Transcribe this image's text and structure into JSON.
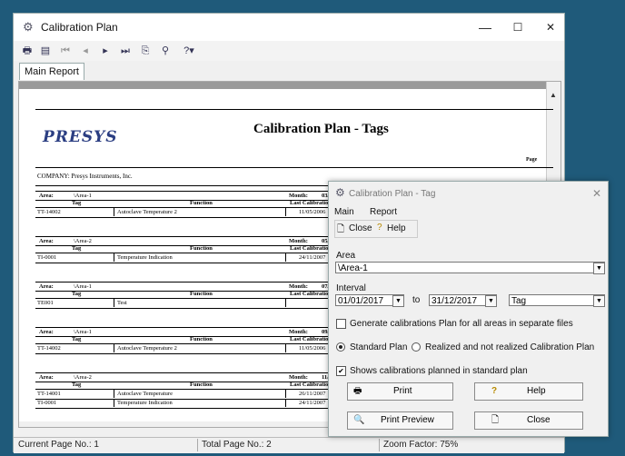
{
  "window": {
    "title": "Calibration Plan",
    "minimize": "—",
    "maximize": "☐",
    "close": "✕"
  },
  "toolbar": {
    "icons": [
      "print-setup-icon",
      "print-icon",
      "first-page-icon",
      "prev-page-icon",
      "next-page-icon",
      "last-page-icon",
      "export-icon",
      "find-icon",
      "help-icon"
    ]
  },
  "tabs": {
    "main": "Main Report"
  },
  "report": {
    "logo": "PRESYS",
    "title": "Calibration Plan - Tags",
    "page_label": "Page",
    "company": "COMPANY: Presys Instruments, Inc.",
    "col_tag": "Tag",
    "col_function": "Function",
    "col_last": "Last Calibratio",
    "area_label": "Area:",
    "month_label": "Month:",
    "sections": [
      {
        "area": "\\Area-1",
        "month": "03/",
        "rows": [
          {
            "tag": "TT-14002",
            "func": "Autoclave Temperature 2",
            "last": "11/05/2006"
          }
        ]
      },
      {
        "area": "\\Area-2",
        "month": "05/",
        "rows": [
          {
            "tag": "TI-0001",
            "func": "Temperature Indication",
            "last": "24/11/2007"
          }
        ]
      },
      {
        "area": "\\Area-1",
        "month": "07/",
        "rows": [
          {
            "tag": "TE001",
            "func": "Test",
            "last": ""
          }
        ]
      },
      {
        "area": "\\Area-1",
        "month": "09/",
        "rows": [
          {
            "tag": "TT-14002",
            "func": "Autoclave Temperature 2",
            "last": "11/05/2006"
          }
        ]
      },
      {
        "area": "\\Area-2",
        "month": "11/",
        "rows": [
          {
            "tag": "TT-14001",
            "func": "Autoclave Temperature",
            "last": "26/11/2007"
          },
          {
            "tag": "TI-0001",
            "func": "Temperature Indication",
            "last": "24/11/2007"
          }
        ]
      }
    ]
  },
  "status": {
    "current": "Current Page No.: 1",
    "total": "Total Page No.: 2",
    "zoom": "Zoom Factor: 75%"
  },
  "dialog": {
    "title": "Calibration Plan - Tag",
    "menu": [
      "Main",
      "Report"
    ],
    "close_btn": "Close",
    "help_btn": "Help",
    "area_label": "Area",
    "area_value": "\\Area-1",
    "interval_label": "Interval",
    "date_from": "01/01/2017",
    "to_label": "to",
    "date_to": "31/12/2017",
    "group_by": "Tag",
    "gen_all_label": "Generate calibrations Plan for all areas in separate files",
    "standard_plan": "Standard Plan",
    "realized_plan": "Realized and not realized Calibration Plan",
    "shows_label": "Shows calibrations planned in standard plan",
    "print": "Print",
    "help": "Help",
    "print_preview": "Print Preview",
    "close": "Close"
  }
}
